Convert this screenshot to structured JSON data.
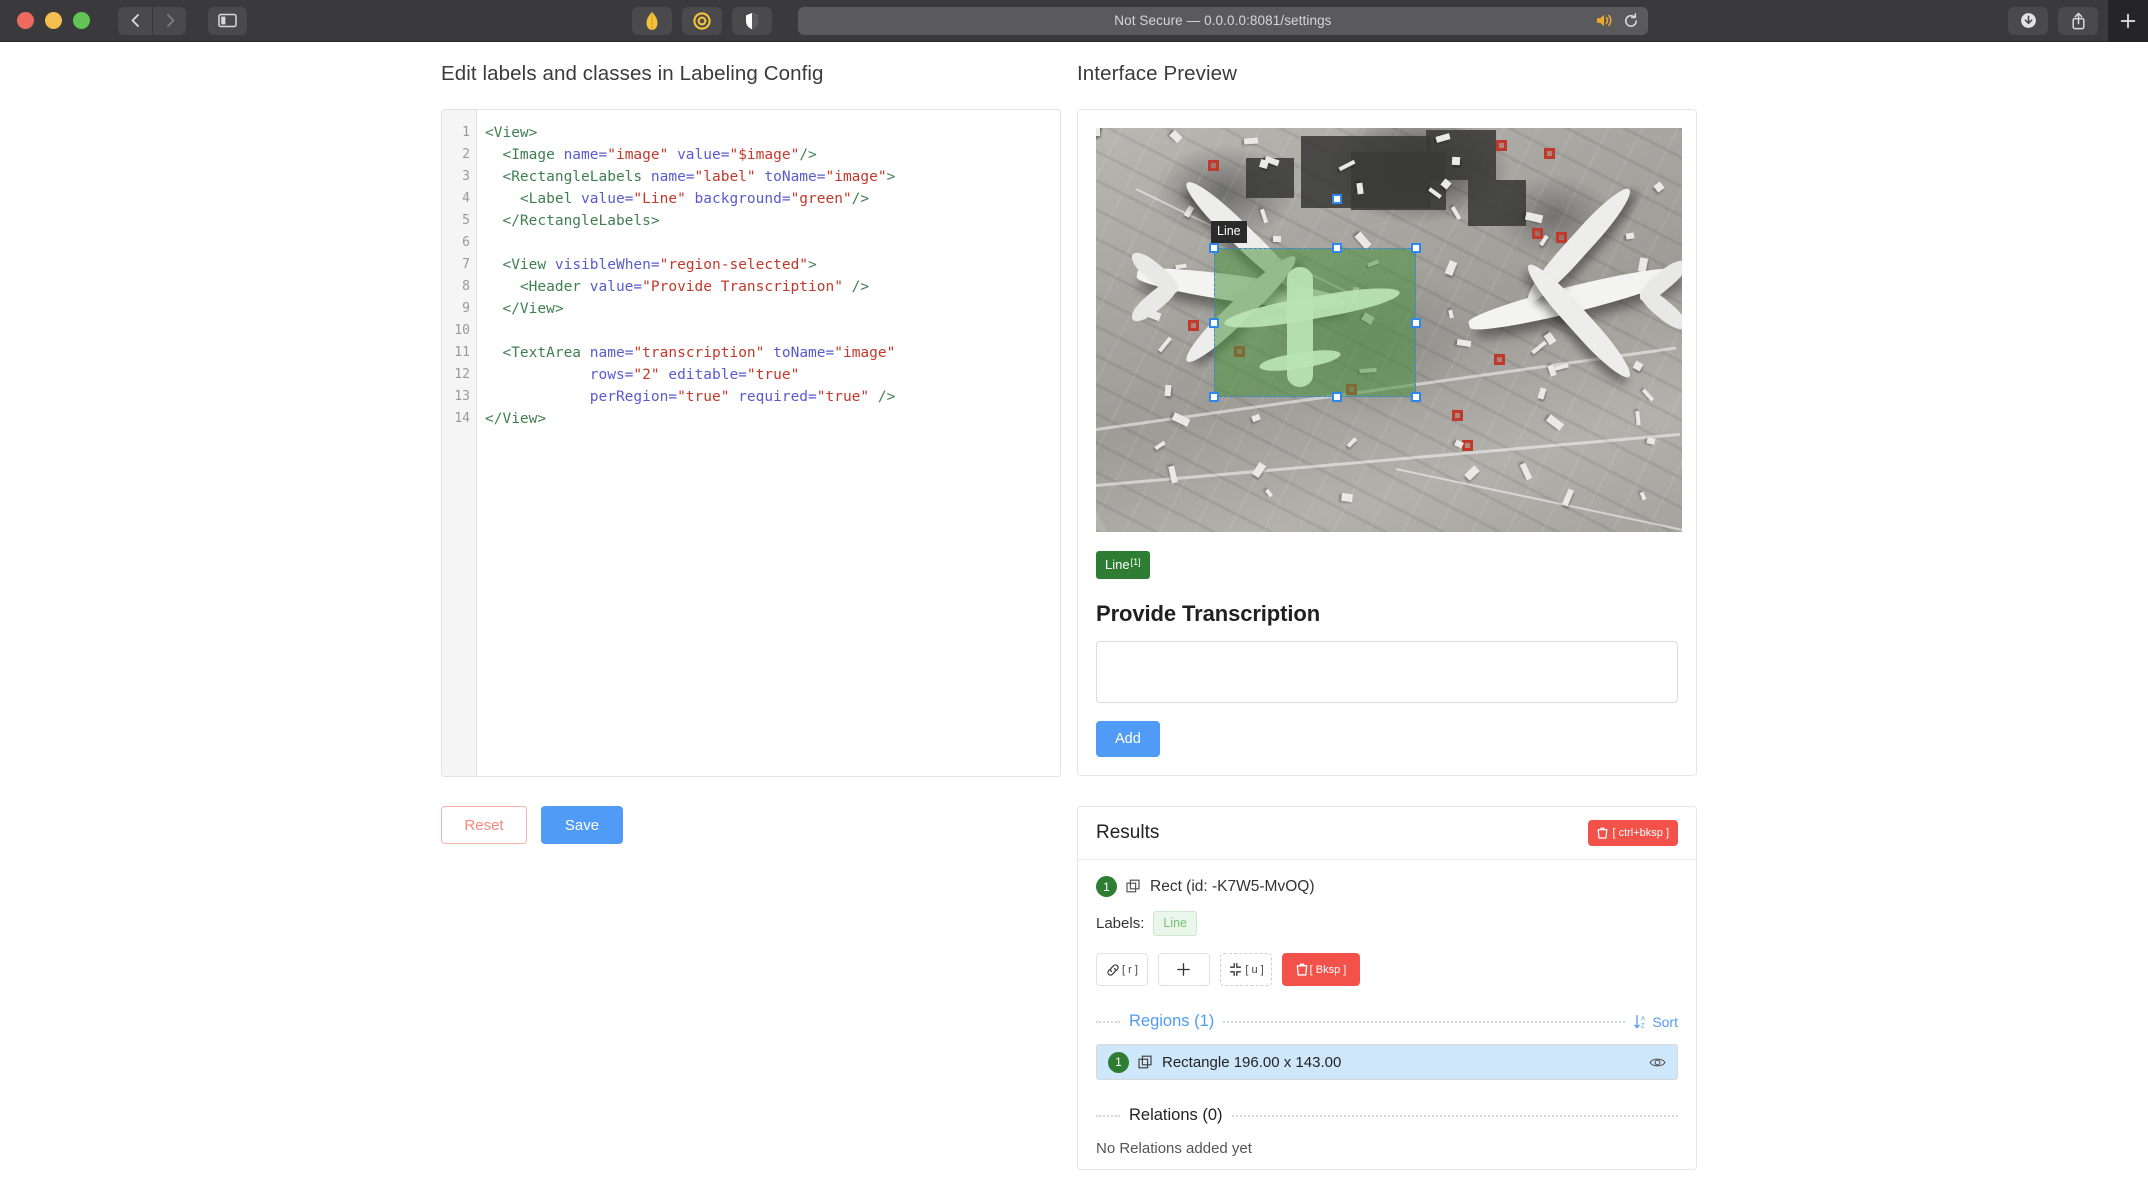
{
  "browser": {
    "url_text": "Not Secure — 0.0.0.0:8081/settings",
    "icons": {
      "back": "back-arrow-icon",
      "forward": "forward-arrow-icon",
      "sidebar": "sidebar-toggle-icon",
      "speaker": "speaker-playing-icon",
      "reload": "reload-icon",
      "download": "download-icon",
      "share": "share-icon",
      "tabs": "tab-overview-icon",
      "newtab": "new-tab-plus-icon"
    }
  },
  "left": {
    "title": "Edit labels and classes in Labeling Config",
    "code_lines": [
      [
        {
          "t": "tag",
          "v": "<View>"
        }
      ],
      [
        {
          "t": "plain",
          "v": "  "
        },
        {
          "t": "tag",
          "v": "<Image "
        },
        {
          "t": "attr",
          "v": "name="
        },
        {
          "t": "val",
          "v": "\"image\" "
        },
        {
          "t": "attr",
          "v": "value="
        },
        {
          "t": "val",
          "v": "\"$image\""
        },
        {
          "t": "tag",
          "v": "/>"
        }
      ],
      [
        {
          "t": "plain",
          "v": "  "
        },
        {
          "t": "tag",
          "v": "<RectangleLabels "
        },
        {
          "t": "attr",
          "v": "name="
        },
        {
          "t": "val",
          "v": "\"label\" "
        },
        {
          "t": "attr",
          "v": "toName="
        },
        {
          "t": "val",
          "v": "\"image\""
        },
        {
          "t": "tag",
          "v": ">"
        }
      ],
      [
        {
          "t": "plain",
          "v": "    "
        },
        {
          "t": "tag",
          "v": "<Label "
        },
        {
          "t": "attr",
          "v": "value="
        },
        {
          "t": "val",
          "v": "\"Line\" "
        },
        {
          "t": "attr",
          "v": "background="
        },
        {
          "t": "val",
          "v": "\"green\""
        },
        {
          "t": "tag",
          "v": "/>"
        }
      ],
      [
        {
          "t": "plain",
          "v": "  "
        },
        {
          "t": "tag",
          "v": "</RectangleLabels>"
        }
      ],
      [],
      [
        {
          "t": "plain",
          "v": "  "
        },
        {
          "t": "tag",
          "v": "<View "
        },
        {
          "t": "attr",
          "v": "visibleWhen="
        },
        {
          "t": "val",
          "v": "\"region-selected\""
        },
        {
          "t": "tag",
          "v": ">"
        }
      ],
      [
        {
          "t": "plain",
          "v": "    "
        },
        {
          "t": "tag",
          "v": "<Header "
        },
        {
          "t": "attr",
          "v": "value="
        },
        {
          "t": "val",
          "v": "\"Provide Transcription\" "
        },
        {
          "t": "tag",
          "v": "/>"
        }
      ],
      [
        {
          "t": "plain",
          "v": "  "
        },
        {
          "t": "tag",
          "v": "</View>"
        }
      ],
      [],
      [
        {
          "t": "plain",
          "v": "  "
        },
        {
          "t": "tag",
          "v": "<TextArea "
        },
        {
          "t": "attr",
          "v": "name="
        },
        {
          "t": "val",
          "v": "\"transcription\" "
        },
        {
          "t": "attr",
          "v": "toName="
        },
        {
          "t": "val",
          "v": "\"image\""
        }
      ],
      [
        {
          "t": "plain",
          "v": "            "
        },
        {
          "t": "attr",
          "v": "rows="
        },
        {
          "t": "val",
          "v": "\"2\" "
        },
        {
          "t": "attr",
          "v": "editable="
        },
        {
          "t": "val",
          "v": "\"true\""
        }
      ],
      [
        {
          "t": "plain",
          "v": "            "
        },
        {
          "t": "attr",
          "v": "perRegion="
        },
        {
          "t": "val",
          "v": "\"true\" "
        },
        {
          "t": "attr",
          "v": "required="
        },
        {
          "t": "val",
          "v": "\"true\" "
        },
        {
          "t": "tag",
          "v": "/>"
        }
      ],
      [
        {
          "t": "tag",
          "v": "</View>"
        }
      ]
    ],
    "line_numbers": [
      "1",
      "2",
      "3",
      "4",
      "5",
      "6",
      "7",
      "8",
      "9",
      "10",
      "11",
      "12",
      "13",
      "14"
    ],
    "reset_label": "Reset",
    "save_label": "Save"
  },
  "right": {
    "title": "Interface Preview",
    "region_tooltip": "Line",
    "label_chip": {
      "text": "Line",
      "hotkey": "[1]"
    },
    "transcription_header": "Provide Transcription",
    "textarea_value": "",
    "textarea_placeholder": "",
    "add_label": "Add"
  },
  "results": {
    "title": "Results",
    "delete_all_hotkey": "[ ctrl+bksp ]",
    "entry": {
      "number": "1",
      "text": "Rect (id: -K7W5-MvOQ)"
    },
    "labels_caption": "Labels:",
    "labels": [
      "Line"
    ],
    "actions": [
      {
        "name": "relation-button",
        "hotkey": "[ r ]",
        "icon": "link-icon"
      },
      {
        "name": "add-button",
        "hotkey": "",
        "icon": "plus-icon"
      },
      {
        "name": "unselect-button",
        "hotkey": "[ u ]",
        "icon": "collapse-icon"
      },
      {
        "name": "delete-button",
        "hotkey": "[ Bksp ]",
        "icon": "trash-icon"
      }
    ],
    "regions_title": "Regions (1)",
    "sort_label": "Sort",
    "region_rows": [
      {
        "number": "1",
        "text": "Rectangle 196.00 x 143.00"
      }
    ],
    "relations_title": "Relations (0)",
    "no_relations": "No Relations added yet"
  },
  "colors": {
    "accent_blue": "#4f9bf5",
    "label_green": "#2e7d32",
    "danger_red": "#f2524a",
    "region_fill": "rgba(76,146,62,0.55)"
  }
}
